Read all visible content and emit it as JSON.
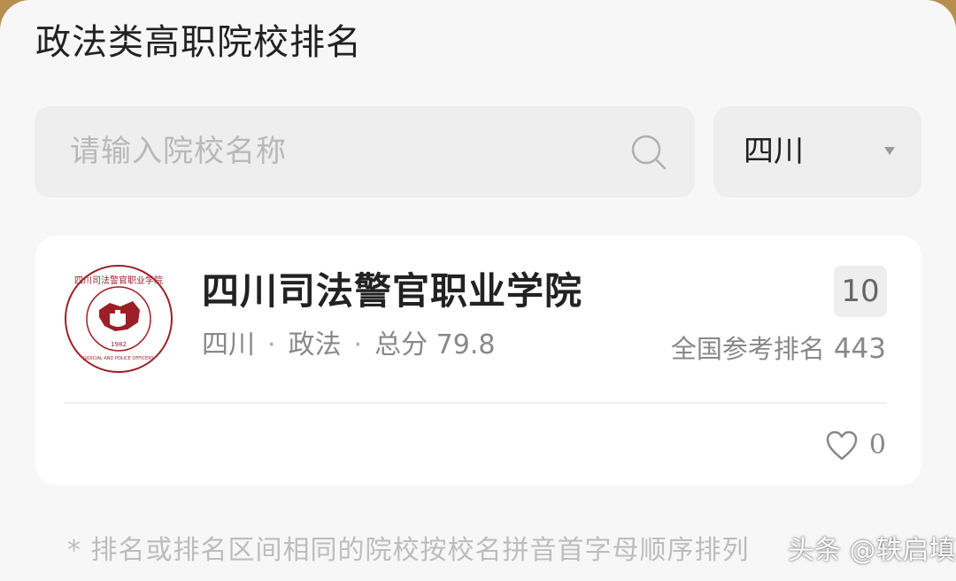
{
  "page": {
    "title": "政法类高职院校排名"
  },
  "search": {
    "placeholder": "请输入院校名称",
    "icon": "search-icon"
  },
  "region_select": {
    "selected": "四川"
  },
  "school_card": {
    "name": "四川司法警官职业学院",
    "logo": {
      "text_top": "四川司法警官职业学院",
      "text_bottom": "SICHUAN JUDICIAL AND POLICE OFFICERS PROFESSIONAL COLLEGE",
      "year": "1982"
    },
    "province": "四川",
    "category": "政法",
    "separator": "·",
    "score_label": "总分",
    "score": "79.8",
    "rank": "10",
    "national_rank_label": "全国参考排名",
    "national_rank": "443",
    "likes": "0"
  },
  "footnote": "* 排名或排名区间相同的院校按校名拼音首字母顺序排列",
  "watermark": "头条 @轶启填",
  "colors": {
    "logo_red": "#9c1f28",
    "background": "#f7f7f7",
    "card": "#ffffff"
  }
}
